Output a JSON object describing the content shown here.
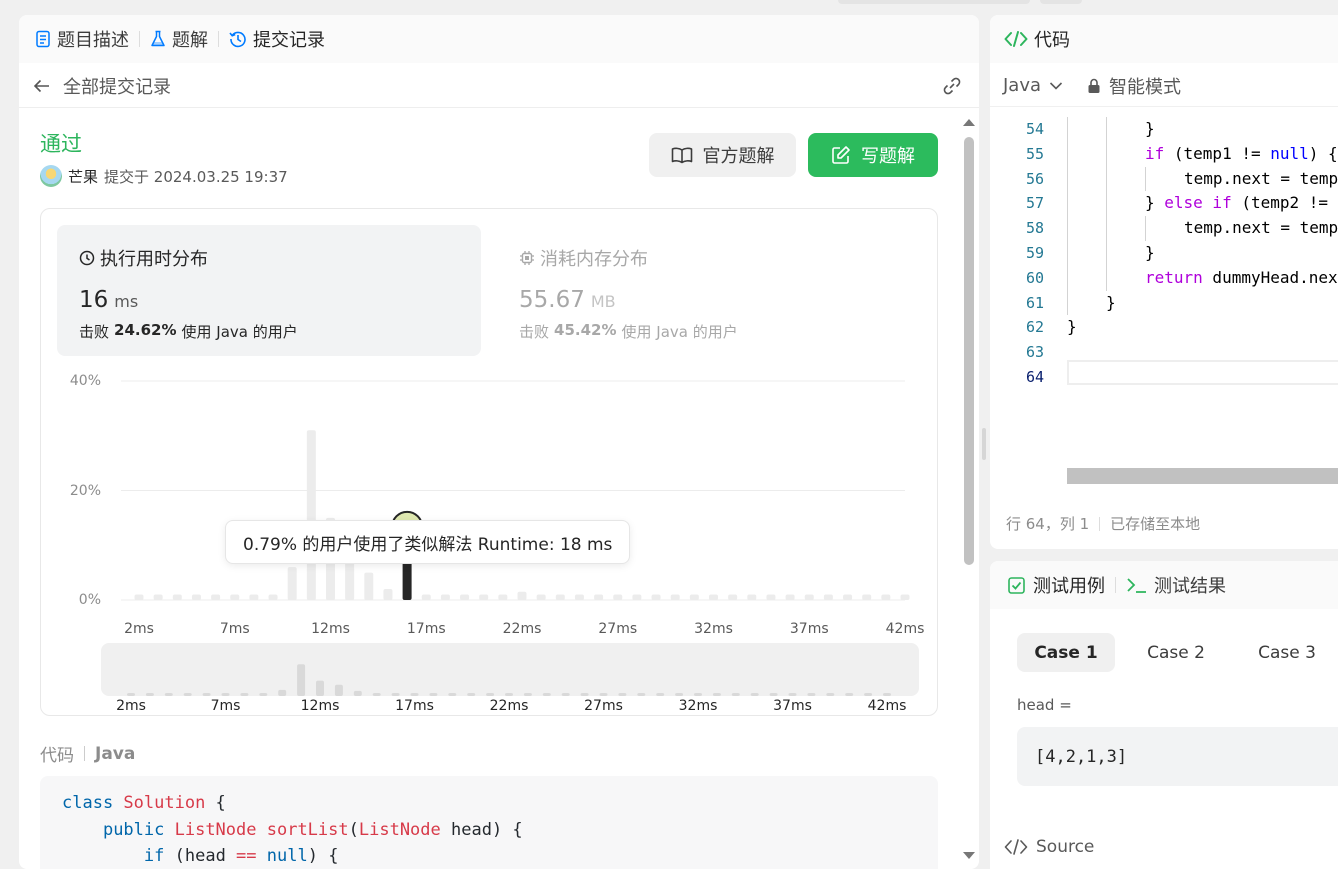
{
  "tabs": {
    "description": "题目描述",
    "solutions": "题解",
    "submissions": "提交记录"
  },
  "submission": {
    "back_label": "全部提交记录",
    "status": "通过",
    "user": "芒果",
    "submitted_at": "提交于 2024.03.25 19:37",
    "official_solution_button": "官方题解",
    "write_solution_button": "写题解"
  },
  "stats": {
    "runtime": {
      "title": "执行用时分布",
      "value": "16",
      "unit": "ms",
      "beats_prefix": "击败",
      "beats_percent": "24.62%",
      "beats_suffix": "使用 Java 的用户"
    },
    "memory": {
      "title": "消耗内存分布",
      "value": "55.67",
      "unit": "MB",
      "beats_prefix": "击败",
      "beats_percent": "45.42%",
      "beats_suffix": "使用 Java 的用户"
    }
  },
  "tooltip": "0.79% 的用户使用了类似解法 Runtime: 18 ms",
  "chart_data": {
    "type": "bar",
    "y_ticks": [
      "40%",
      "20%",
      "0%"
    ],
    "ylim": [
      0,
      40
    ],
    "x_ticks": [
      "2ms",
      "7ms",
      "12ms",
      "17ms",
      "22ms",
      "27ms",
      "32ms",
      "37ms",
      "42ms"
    ],
    "categories": [
      "2",
      "3",
      "4",
      "5",
      "6",
      "7",
      "8",
      "9",
      "10",
      "11",
      "12",
      "13",
      "14",
      "15",
      "16",
      "17",
      "18",
      "19",
      "20",
      "21",
      "22",
      "23",
      "24",
      "25",
      "26",
      "27",
      "28",
      "29",
      "30",
      "31",
      "32",
      "33",
      "34",
      "35",
      "36",
      "37",
      "38",
      "39",
      "40",
      "41",
      "42"
    ],
    "values": [
      1,
      1,
      1,
      1,
      1,
      1,
      1,
      1,
      6,
      31,
      15,
      11,
      5,
      2,
      2,
      1,
      1,
      1,
      1,
      1,
      1.5,
      1,
      1,
      1,
      1,
      1,
      1,
      1,
      1,
      1,
      1,
      1,
      1,
      1,
      1,
      1,
      1,
      1,
      1,
      1,
      1
    ],
    "highlight_category": "16",
    "highlight_value": 13,
    "bar_color": "#ececec",
    "highlight_color": "#262626",
    "grid": true
  },
  "minimap": {
    "x_ticks": [
      "2ms",
      "7ms",
      "12ms",
      "17ms",
      "22ms",
      "27ms",
      "32ms",
      "37ms",
      "42ms"
    ]
  },
  "code_section": {
    "label": "代码",
    "language": "Java",
    "lines": [
      {
        "indent": "",
        "parts": [
          [
            "class ",
            "cj"
          ],
          [
            "Solution",
            "cr"
          ],
          [
            " {",
            "cp"
          ]
        ]
      },
      {
        "indent": "    ",
        "parts": [
          [
            "public ",
            "cj"
          ],
          [
            "ListNode ",
            "cr"
          ],
          [
            "sortList",
            "cr"
          ],
          [
            "(",
            "cp"
          ],
          [
            "ListNode ",
            "cr"
          ],
          [
            "head",
            "cp"
          ],
          [
            ") {",
            "cp"
          ]
        ]
      },
      {
        "indent": "        ",
        "parts": [
          [
            "if ",
            "cj"
          ],
          [
            "(",
            "cp"
          ],
          [
            "head ",
            "cp"
          ],
          [
            "== ",
            "cr"
          ],
          [
            "null",
            "cj"
          ],
          [
            ") {",
            "cp"
          ]
        ]
      }
    ]
  },
  "editor": {
    "header_title": "代码",
    "language": "Java",
    "mode": "智能模式",
    "lines": [
      {
        "n": "54",
        "indent": 2,
        "parts": [
          [
            "}",
            "plain"
          ]
        ]
      },
      {
        "n": "55",
        "indent": 2,
        "parts": [
          [
            "if",
            "kw2"
          ],
          [
            " (temp1 != ",
            "plain"
          ],
          [
            "null",
            "kw"
          ],
          [
            ") {",
            "plain"
          ]
        ]
      },
      {
        "n": "56",
        "indent": 3,
        "parts": [
          [
            "temp.next = temp",
            "plain"
          ]
        ]
      },
      {
        "n": "57",
        "indent": 2,
        "parts": [
          [
            "} ",
            "plain"
          ],
          [
            "else if",
            "kw2"
          ],
          [
            " (temp2 !=",
            "plain"
          ]
        ]
      },
      {
        "n": "58",
        "indent": 3,
        "parts": [
          [
            "temp.next = temp",
            "plain"
          ]
        ]
      },
      {
        "n": "59",
        "indent": 2,
        "parts": [
          [
            "}",
            "plain"
          ]
        ]
      },
      {
        "n": "60",
        "indent": 2,
        "parts": [
          [
            "return",
            "kw2"
          ],
          [
            " dummyHead.nex",
            "plain"
          ]
        ]
      },
      {
        "n": "61",
        "indent": 1,
        "parts": [
          [
            "}",
            "plain"
          ]
        ]
      },
      {
        "n": "62",
        "indent": 0,
        "parts": [
          [
            "}",
            "plain"
          ]
        ]
      },
      {
        "n": "63",
        "indent": 0,
        "parts": []
      },
      {
        "n": "64",
        "indent": 0,
        "parts": []
      }
    ],
    "status_position": "行 64，列 1",
    "status_saved": "已存储至本地"
  },
  "testcase": {
    "tab_cases": "测试用例",
    "tab_result": "测试结果",
    "cases": [
      "Case 1",
      "Case 2",
      "Case 3"
    ],
    "param_label": "head =",
    "param_value": "[4,2,1,3]",
    "source_label": "Source"
  }
}
